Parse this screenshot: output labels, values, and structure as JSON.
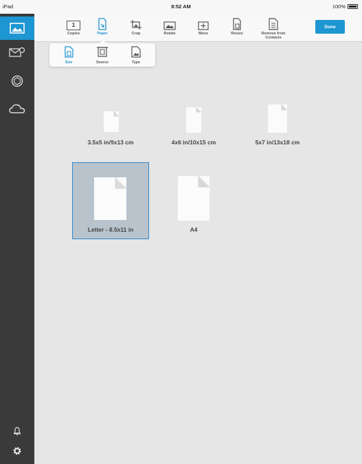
{
  "status_bar": {
    "device": "iPad",
    "time": "8:52 AM",
    "battery": "100%"
  },
  "sidebar": {
    "items": [
      "photos-icon",
      "email-icon",
      "aperture-icon",
      "cloud-icon",
      "bell-icon",
      "gear-icon"
    ]
  },
  "toolbar": {
    "copies_count": "1",
    "tools": [
      {
        "label": "Copies"
      },
      {
        "label": "Paper"
      },
      {
        "label": "Crop"
      },
      {
        "label": "Rotate"
      },
      {
        "label": "Move"
      },
      {
        "label": "Resize"
      },
      {
        "label": "Remove from Contacts"
      }
    ],
    "done_label": "Done"
  },
  "popover": {
    "items": [
      {
        "label": "Size"
      },
      {
        "label": "Source"
      },
      {
        "label": "Type"
      }
    ]
  },
  "sizes": [
    {
      "label": "3.5x5 in/9x13 cm"
    },
    {
      "label": "4x6 in/10x15 cm"
    },
    {
      "label": "5x7 in/13x18 cm"
    },
    {
      "label": "Letter - 8.5x11 in"
    },
    {
      "label": "A4"
    }
  ],
  "colors": {
    "accent": "#1d96d1",
    "sidebar": "#3a3a3a",
    "selected_tile": "#b9c3cb"
  }
}
